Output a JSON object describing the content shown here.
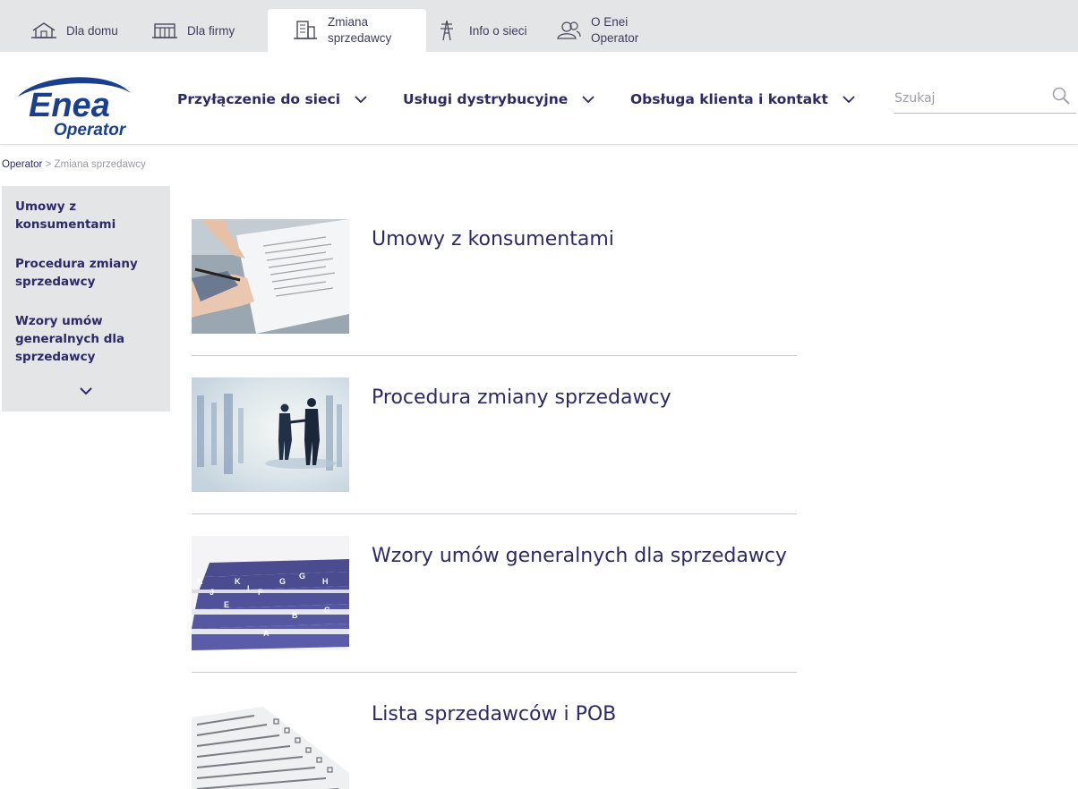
{
  "topbar": {
    "items": [
      {
        "label": "Dla domu",
        "icon": "house-icon"
      },
      {
        "label": "Dla firmy",
        "icon": "building-icon"
      },
      {
        "label": "Zmiana sprzedawcy",
        "line1": "Zmiana",
        "line2": "sprzedawcy",
        "icon": "office-building-icon",
        "active": true
      },
      {
        "label": "Info o sieci",
        "icon": "power-pylon-icon"
      },
      {
        "label": "O Enei Operator",
        "line1": "O Enei",
        "line2": "Operator",
        "icon": "people-icon"
      }
    ]
  },
  "logo": {
    "line1": "Enea",
    "line2": "Operator"
  },
  "nav": {
    "items": [
      {
        "label": "Przyłączenie do sieci"
      },
      {
        "label": "Usługi dystrybucyjne"
      },
      {
        "label": "Obsługa klienta i kontakt"
      }
    ]
  },
  "search": {
    "placeholder": "Szukaj",
    "icon": "search-icon"
  },
  "breadcrumb": {
    "home": "Operator",
    "separator": ">",
    "current": "Zmiana sprzedawcy"
  },
  "sidebar": {
    "items": [
      {
        "line1": "Umowy z",
        "line2": "konsumentami"
      },
      {
        "line1": "Procedura zmiany",
        "line2": "sprzedawcy"
      },
      {
        "line1": "Wzory umów",
        "line2": "generalnych dla",
        "line3": "sprzedawcy"
      }
    ],
    "more_icon": "chevron-down-icon"
  },
  "entries": [
    {
      "title": "Umowy z konsumentami",
      "image": "signing-document-photo"
    },
    {
      "title": "Procedura zmiany sprzedawcy",
      "image": "handshake-photo"
    },
    {
      "title": "Wzory umów generalnych dla sprzedawcy",
      "image": "file-index-tabs-photo"
    },
    {
      "title": "Lista sprzedawców i POB",
      "image": "checklist-paper-photo"
    }
  ],
  "colors": {
    "brand": "#2b2a66",
    "logo_blue": "#1b3f8f",
    "topbar": "#e4e5e7",
    "sidebar": "#e4e5e7"
  }
}
